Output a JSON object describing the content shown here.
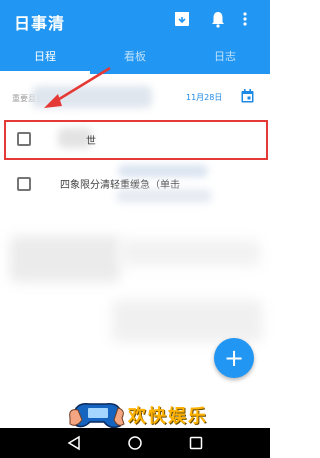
{
  "app": {
    "title": "日事清"
  },
  "appbar_icons": [
    "archive-icon",
    "bell-icon",
    "more-vert-icon"
  ],
  "tabs": [
    {
      "label": "日程",
      "active": true
    },
    {
      "label": "看板",
      "active": false
    },
    {
      "label": "日志",
      "active": false
    }
  ],
  "section": {
    "label": "重要且紧急",
    "date": "11月28日"
  },
  "tasks": [
    {
      "text": "世",
      "checked": false
    },
    {
      "text": "四象限分清轻重缓急（单击",
      "checked": false
    }
  ],
  "fab": {
    "label": "+"
  },
  "watermark": {
    "text": "欢快娱乐"
  },
  "colors": {
    "primary": "#2196f3",
    "highlight": "#e53935",
    "watermark": "#ffb300"
  }
}
